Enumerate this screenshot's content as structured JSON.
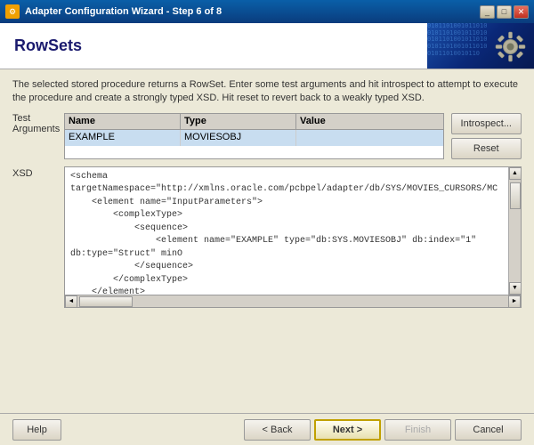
{
  "titleBar": {
    "icon": "⚙",
    "title": "Adapter Configuration Wizard - Step 6 of 8",
    "controls": [
      "_",
      "□",
      "✕"
    ]
  },
  "header": {
    "title": "RowSets",
    "matrixText": "010110100101101001011010010110"
  },
  "description": "The selected stored procedure returns a RowSet.  Enter some test arguments and hit introspect to attempt to execute the procedure and create a strongly typed XSD.  Hit reset to revert back to a weakly typed XSD.",
  "testArguments": {
    "label": "Test\nArguments",
    "table": {
      "columns": [
        "Name",
        "Type",
        "Value"
      ],
      "rows": [
        {
          "name": "EXAMPLE",
          "type": "MOVIESOBJ",
          "value": ""
        }
      ]
    },
    "buttons": {
      "introspect": "Introspect...",
      "reset": "Reset"
    }
  },
  "xsd": {
    "label": "XSD",
    "content": "<schema targetNamespace=\"http://xmlns.oracle.com/pcbpel/adapter/db/SYS/MOVIES_CURSORS/MC\n    <element name=\"InputParameters\">\n        <complexType>\n            <sequence>\n                <element name=\"EXAMPLE\" type=\"db:SYS.MOVIESOBJ\" db:index=\"1\" db:type=\"Struct\" minO\n            </sequence>\n        </complexType>\n    </element>\n    <element name=\"OutputParameters\">\n        <complexType>\n            <sequence>\n                <element name=\"MOVIES\" type=\"db:RowSet\" db:index=\"2\" db:type=\"RowSet\" minOccurs=\"C"
  },
  "bottomBar": {
    "help": "Help",
    "back": "< Back",
    "next": "Next >",
    "finish": "Finish",
    "cancel": "Cancel"
  }
}
